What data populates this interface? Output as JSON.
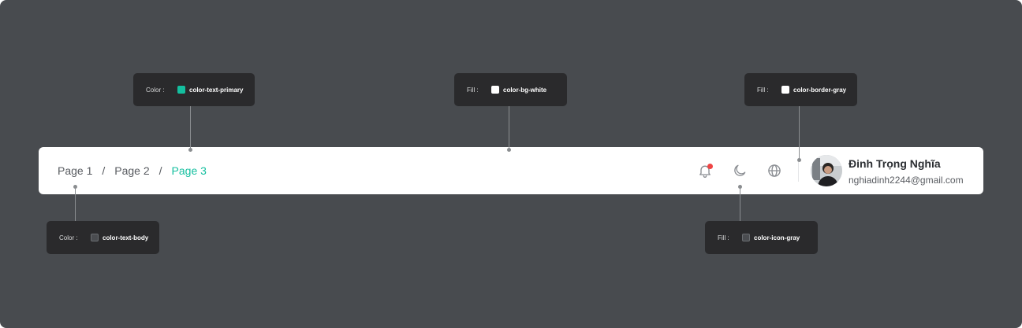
{
  "header": {
    "breadcrumb": [
      {
        "label": "Page 1",
        "active": false
      },
      {
        "label": "Page 2",
        "active": false
      },
      {
        "label": "Page 3",
        "active": true
      }
    ],
    "separator": "/",
    "notifications": {
      "has_unread": true
    },
    "user": {
      "name": "Đinh Trọng Nghĩa",
      "email": "nghiadinh2244@gmail.com"
    }
  },
  "callouts": {
    "text_primary": {
      "kind": "Color :",
      "token": "color-text-primary",
      "swatch": "#14bf9f"
    },
    "bg_white": {
      "kind": "Fill :",
      "token": "color-bg-white",
      "swatch": "#ffffff"
    },
    "border_gray": {
      "kind": "Fill :",
      "token": "color-border-gray",
      "swatch": "#ffffff"
    },
    "text_body": {
      "kind": "Color :",
      "token": "color-text-body",
      "swatch": "#4a4c50"
    },
    "icon_gray": {
      "kind": "Fill :",
      "token": "color-icon-gray",
      "swatch": "#4a4c50"
    }
  },
  "colors": {
    "canvas": "#484b4f",
    "primary": "#14bf9f",
    "body_text": "#585b60",
    "icon_gray": "#8a8d92",
    "border_gray": "#e5e6e8",
    "notification": "#ef4444"
  },
  "icons": [
    "bell-icon",
    "moon-icon",
    "globe-icon"
  ]
}
